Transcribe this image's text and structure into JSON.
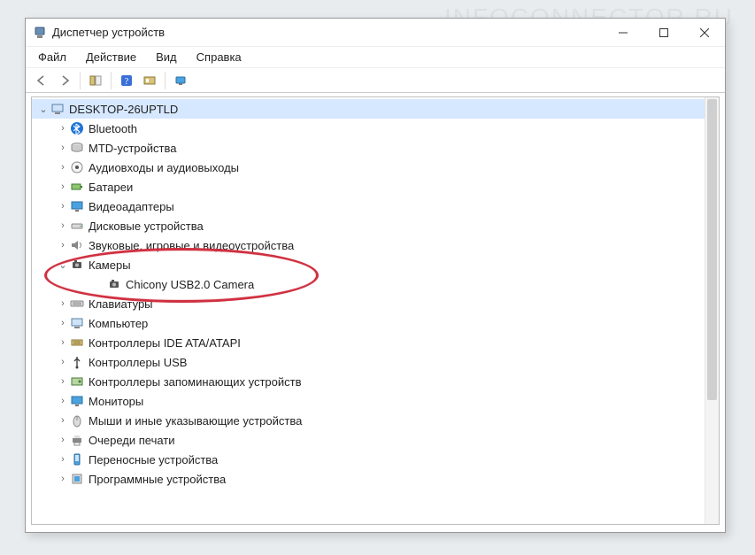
{
  "window": {
    "title": "Диспетчер устройств"
  },
  "menu": {
    "file": "Файл",
    "action": "Действие",
    "view": "Вид",
    "help": "Справка"
  },
  "tree": {
    "root": "DESKTOP-26UPTLD",
    "items": [
      {
        "icon": "bluetooth",
        "label": "Bluetooth"
      },
      {
        "icon": "disk",
        "label": "MTD-устройства"
      },
      {
        "icon": "audio",
        "label": "Аудиовходы и аудиовыходы"
      },
      {
        "icon": "battery",
        "label": "Батареи"
      },
      {
        "icon": "display",
        "label": "Видеоадаптеры"
      },
      {
        "icon": "drive",
        "label": "Дисковые устройства"
      },
      {
        "icon": "sound",
        "label": "Звуковые, игровые и видеоустройства"
      },
      {
        "icon": "camera",
        "label": "Камеры",
        "expanded": true,
        "children": [
          {
            "icon": "camera",
            "label": "Chicony USB2.0 Camera"
          }
        ]
      },
      {
        "icon": "keyboard",
        "label": "Клавиатуры"
      },
      {
        "icon": "computer",
        "label": "Компьютер"
      },
      {
        "icon": "ide",
        "label": "Контроллеры IDE ATA/ATAPI"
      },
      {
        "icon": "usb",
        "label": "Контроллеры USB"
      },
      {
        "icon": "storage",
        "label": "Контроллеры запоминающих устройств"
      },
      {
        "icon": "monitor",
        "label": "Мониторы"
      },
      {
        "icon": "mouse",
        "label": "Мыши и иные указывающие устройства"
      },
      {
        "icon": "printer",
        "label": "Очереди печати"
      },
      {
        "icon": "portable",
        "label": "Переносные устройства"
      },
      {
        "icon": "software",
        "label": "Программные устройства"
      }
    ]
  },
  "watermark": "INFOCONNECTOR RU"
}
